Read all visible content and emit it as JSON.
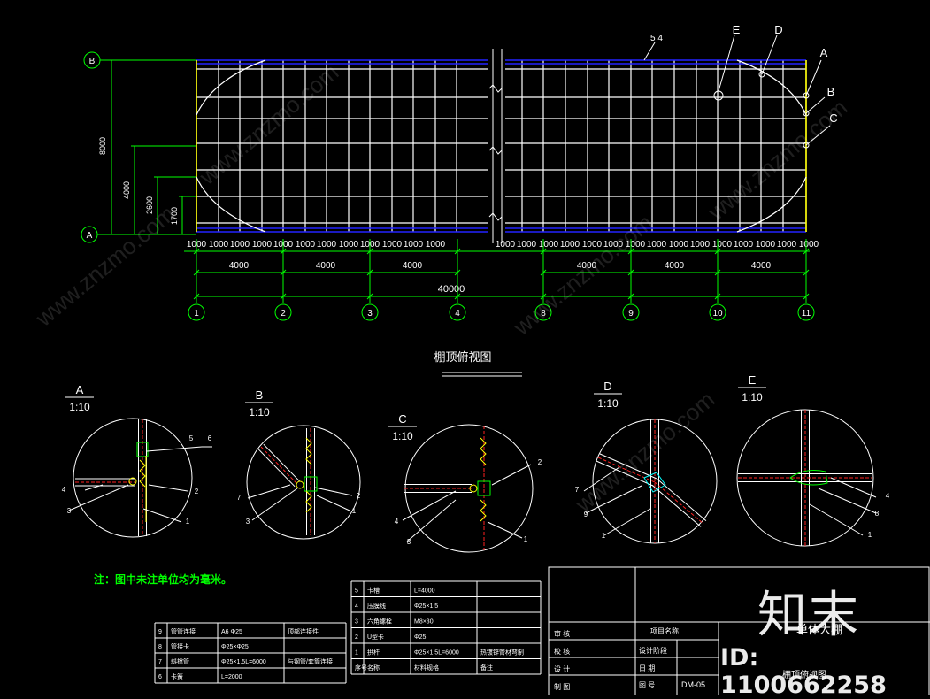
{
  "grid_axes": {
    "left": [
      "B",
      "A"
    ],
    "bottom": [
      "1",
      "2",
      "3",
      "4",
      "8",
      "9",
      "10",
      "11"
    ]
  },
  "dimensions": {
    "height_total": "8000",
    "height_mid": "4000",
    "height_a": "2600",
    "height_b": "1700",
    "spacing": [
      "1000",
      "1000",
      "1000",
      "1000",
      "1000",
      "1000",
      "1000",
      "1000",
      "1000",
      "1000",
      "1000",
      "1000",
      "1000",
      "1000",
      "1000",
      "1000",
      "1000",
      "1000",
      "1000",
      "1000",
      "1000",
      "1000",
      "1000",
      "1000",
      "1000",
      "1000",
      "1000",
      "1000",
      "1000",
      "1000",
      "1000",
      "1000",
      "1000"
    ],
    "bays": [
      "4000",
      "4000",
      "4000",
      "4000",
      "4000",
      "4000"
    ],
    "overall": "40000"
  },
  "plan_title": "棚顶俯视图",
  "callouts": {
    "parts_top": "5  4",
    "details": [
      "E",
      "D",
      "A",
      "B",
      "C"
    ]
  },
  "details": [
    {
      "key": "A",
      "scale": "1:10",
      "labels": [
        "5",
        "6",
        "4",
        "3",
        "2",
        "1"
      ]
    },
    {
      "key": "B",
      "scale": "1:10",
      "labels": [
        "7",
        "2",
        "3",
        "1"
      ]
    },
    {
      "key": "C",
      "scale": "1:10",
      "labels": [
        "2",
        "4",
        "3",
        "1"
      ]
    },
    {
      "key": "D",
      "scale": "1:10",
      "labels": [
        "7",
        "9",
        "1"
      ]
    },
    {
      "key": "E",
      "scale": "1:10",
      "labels": [
        "4",
        "8",
        "1"
      ]
    }
  ],
  "note": "注：图中未注单位均为毫米。",
  "bom_left": {
    "rows": [
      {
        "no": "9",
        "name": "管管连接",
        "spec": "A6  Φ25",
        "remark": "顶部连接件"
      },
      {
        "no": "8",
        "name": "管接卡",
        "spec": "Φ25×Φ25",
        "remark": ""
      },
      {
        "no": "7",
        "name": "斜撑管",
        "spec": "Φ25×1.5L=6000",
        "remark": "与钢管/套筒连接"
      },
      {
        "no": "6",
        "name": "卡簧",
        "spec": "L=2000",
        "remark": ""
      }
    ]
  },
  "bom_right": {
    "rows": [
      {
        "no": "5",
        "name": "卡槽",
        "spec": "L=4000",
        "remark": ""
      },
      {
        "no": "4",
        "name": "压膜线",
        "spec": "Φ25×1.5",
        "remark": ""
      },
      {
        "no": "3",
        "name": "六角螺栓",
        "spec": "M8×30",
        "remark": ""
      },
      {
        "no": "2",
        "name": "U型卡",
        "spec": "Φ25",
        "remark": ""
      },
      {
        "no": "1",
        "name": "拱杆",
        "spec": "Φ25×1.5L=6000",
        "remark": "热镀锌管材弯制"
      }
    ],
    "header": {
      "no": "序号",
      "name": "名称",
      "spec": "材料规格",
      "remark": "备注"
    }
  },
  "title_block": {
    "labels_left": [
      "审  核",
      "校  核",
      "设  计",
      "制  图"
    ],
    "project_label": "项目名称",
    "design_stage": "设计阶段",
    "date_label": "日  期",
    "drawing_no_label": "图  号",
    "drawing_no": "DM-05",
    "project_name": "单体大棚",
    "drawing_name": "棚顶俯视图"
  },
  "watermark": {
    "logo": "知末",
    "id": "ID: 1100662258",
    "site": "www.znzmo.com"
  },
  "colors": {
    "line_white": "#ffffff",
    "dim_green": "#00ff00",
    "purlin_blue": "#2222ff",
    "leader_white": "#ffffff",
    "yellow": "#ffff00",
    "red": "#ff2020",
    "note_green": "#00ff00"
  }
}
